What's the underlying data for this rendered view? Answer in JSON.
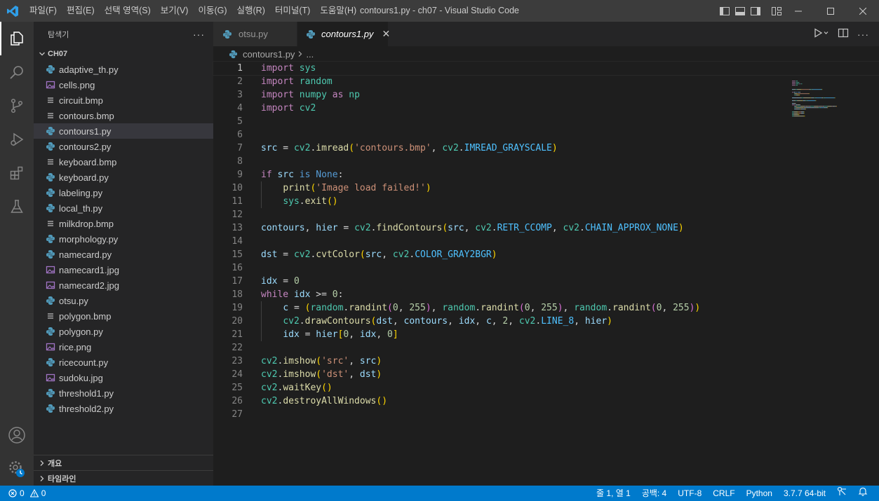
{
  "window": {
    "title": "contours1.py - ch07 - Visual Studio Code",
    "menu": [
      "파일(F)",
      "편집(E)",
      "선택 영역(S)",
      "보기(V)",
      "이동(G)",
      "실행(R)",
      "터미널(T)",
      "도움말(H)"
    ]
  },
  "sidebar": {
    "title": "탐색기",
    "folder": "CH07",
    "files": [
      {
        "name": "adaptive_th.py",
        "type": "python"
      },
      {
        "name": "cells.png",
        "type": "image"
      },
      {
        "name": "circuit.bmp",
        "type": "bitmap"
      },
      {
        "name": "contours.bmp",
        "type": "bitmap"
      },
      {
        "name": "contours1.py",
        "type": "python",
        "selected": true
      },
      {
        "name": "contours2.py",
        "type": "python"
      },
      {
        "name": "keyboard.bmp",
        "type": "bitmap"
      },
      {
        "name": "keyboard.py",
        "type": "python"
      },
      {
        "name": "labeling.py",
        "type": "python"
      },
      {
        "name": "local_th.py",
        "type": "python"
      },
      {
        "name": "milkdrop.bmp",
        "type": "bitmap"
      },
      {
        "name": "morphology.py",
        "type": "python"
      },
      {
        "name": "namecard.py",
        "type": "python"
      },
      {
        "name": "namecard1.jpg",
        "type": "image"
      },
      {
        "name": "namecard2.jpg",
        "type": "image"
      },
      {
        "name": "otsu.py",
        "type": "python"
      },
      {
        "name": "polygon.bmp",
        "type": "bitmap"
      },
      {
        "name": "polygon.py",
        "type": "python"
      },
      {
        "name": "rice.png",
        "type": "image"
      },
      {
        "name": "ricecount.py",
        "type": "python"
      },
      {
        "name": "sudoku.jpg",
        "type": "image"
      },
      {
        "name": "threshold1.py",
        "type": "python"
      },
      {
        "name": "threshold2.py",
        "type": "python"
      }
    ],
    "outline_label": "개요",
    "timeline_label": "타임라인"
  },
  "tabs": [
    {
      "label": "otsu.py",
      "active": false
    },
    {
      "label": "contours1.py",
      "active": true
    }
  ],
  "breadcrumb": {
    "file": "contours1.py",
    "more": "..."
  },
  "editor": {
    "current_line": 1,
    "lines": [
      [
        [
          "kw",
          "import"
        ],
        [
          "pl",
          " "
        ],
        [
          "md",
          "sys"
        ]
      ],
      [
        [
          "kw",
          "import"
        ],
        [
          "pl",
          " "
        ],
        [
          "md",
          "random"
        ]
      ],
      [
        [
          "kw",
          "import"
        ],
        [
          "pl",
          " "
        ],
        [
          "md",
          "numpy"
        ],
        [
          "pl",
          " "
        ],
        [
          "kw",
          "as"
        ],
        [
          "pl",
          " "
        ],
        [
          "md",
          "np"
        ]
      ],
      [
        [
          "kw",
          "import"
        ],
        [
          "pl",
          " "
        ],
        [
          "md",
          "cv2"
        ]
      ],
      [],
      [],
      [
        [
          "vr",
          "src"
        ],
        [
          "pl",
          " = "
        ],
        [
          "md",
          "cv2"
        ],
        [
          "pl",
          "."
        ],
        [
          "fn",
          "imread"
        ],
        [
          "br1",
          "("
        ],
        [
          "st",
          "'contours.bmp'"
        ],
        [
          "pl",
          ", "
        ],
        [
          "md",
          "cv2"
        ],
        [
          "pl",
          "."
        ],
        [
          "cn",
          "IMREAD_GRAYSCALE"
        ],
        [
          "br1",
          ")"
        ]
      ],
      [],
      [
        [
          "kw",
          "if"
        ],
        [
          "pl",
          " "
        ],
        [
          "vr",
          "src"
        ],
        [
          "pl",
          " "
        ],
        [
          "bl",
          "is"
        ],
        [
          "pl",
          " "
        ],
        [
          "bl",
          "None"
        ],
        [
          "pl",
          ":"
        ]
      ],
      [
        [
          "pl",
          "    "
        ],
        [
          "fn",
          "print"
        ],
        [
          "br1",
          "("
        ],
        [
          "st",
          "'Image load failed!'"
        ],
        [
          "br1",
          ")"
        ]
      ],
      [
        [
          "pl",
          "    "
        ],
        [
          "md",
          "sys"
        ],
        [
          "pl",
          "."
        ],
        [
          "fn",
          "exit"
        ],
        [
          "br1",
          "()"
        ]
      ],
      [],
      [
        [
          "vr",
          "contours"
        ],
        [
          "pl",
          ", "
        ],
        [
          "vr",
          "hier"
        ],
        [
          "pl",
          " = "
        ],
        [
          "md",
          "cv2"
        ],
        [
          "pl",
          "."
        ],
        [
          "fn",
          "findContours"
        ],
        [
          "br1",
          "("
        ],
        [
          "vr",
          "src"
        ],
        [
          "pl",
          ", "
        ],
        [
          "md",
          "cv2"
        ],
        [
          "pl",
          "."
        ],
        [
          "cn",
          "RETR_CCOMP"
        ],
        [
          "pl",
          ", "
        ],
        [
          "md",
          "cv2"
        ],
        [
          "pl",
          "."
        ],
        [
          "cn",
          "CHAIN_APPROX_NONE"
        ],
        [
          "br1",
          ")"
        ]
      ],
      [],
      [
        [
          "vr",
          "dst"
        ],
        [
          "pl",
          " = "
        ],
        [
          "md",
          "cv2"
        ],
        [
          "pl",
          "."
        ],
        [
          "fn",
          "cvtColor"
        ],
        [
          "br1",
          "("
        ],
        [
          "vr",
          "src"
        ],
        [
          "pl",
          ", "
        ],
        [
          "md",
          "cv2"
        ],
        [
          "pl",
          "."
        ],
        [
          "cn",
          "COLOR_GRAY2BGR"
        ],
        [
          "br1",
          ")"
        ]
      ],
      [],
      [
        [
          "vr",
          "idx"
        ],
        [
          "pl",
          " = "
        ],
        [
          "nm",
          "0"
        ]
      ],
      [
        [
          "kw",
          "while"
        ],
        [
          "pl",
          " "
        ],
        [
          "vr",
          "idx"
        ],
        [
          "pl",
          " >= "
        ],
        [
          "nm",
          "0"
        ],
        [
          "pl",
          ":"
        ]
      ],
      [
        [
          "pl",
          "    "
        ],
        [
          "vr",
          "c"
        ],
        [
          "pl",
          " = "
        ],
        [
          "br1",
          "("
        ],
        [
          "md",
          "random"
        ],
        [
          "pl",
          "."
        ],
        [
          "fn",
          "randint"
        ],
        [
          "br2",
          "("
        ],
        [
          "nm",
          "0"
        ],
        [
          "pl",
          ", "
        ],
        [
          "nm",
          "255"
        ],
        [
          "br2",
          ")"
        ],
        [
          "pl",
          ", "
        ],
        [
          "md",
          "random"
        ],
        [
          "pl",
          "."
        ],
        [
          "fn",
          "randint"
        ],
        [
          "br2",
          "("
        ],
        [
          "nm",
          "0"
        ],
        [
          "pl",
          ", "
        ],
        [
          "nm",
          "255"
        ],
        [
          "br2",
          ")"
        ],
        [
          "pl",
          ", "
        ],
        [
          "md",
          "random"
        ],
        [
          "pl",
          "."
        ],
        [
          "fn",
          "randint"
        ],
        [
          "br2",
          "("
        ],
        [
          "nm",
          "0"
        ],
        [
          "pl",
          ", "
        ],
        [
          "nm",
          "255"
        ],
        [
          "br2",
          ")"
        ],
        [
          "br1",
          ")"
        ]
      ],
      [
        [
          "pl",
          "    "
        ],
        [
          "md",
          "cv2"
        ],
        [
          "pl",
          "."
        ],
        [
          "fn",
          "drawContours"
        ],
        [
          "br1",
          "("
        ],
        [
          "vr",
          "dst"
        ],
        [
          "pl",
          ", "
        ],
        [
          "vr",
          "contours"
        ],
        [
          "pl",
          ", "
        ],
        [
          "vr",
          "idx"
        ],
        [
          "pl",
          ", "
        ],
        [
          "vr",
          "c"
        ],
        [
          "pl",
          ", "
        ],
        [
          "nm",
          "2"
        ],
        [
          "pl",
          ", "
        ],
        [
          "md",
          "cv2"
        ],
        [
          "pl",
          "."
        ],
        [
          "cn",
          "LINE_8"
        ],
        [
          "pl",
          ", "
        ],
        [
          "vr",
          "hier"
        ],
        [
          "br1",
          ")"
        ]
      ],
      [
        [
          "pl",
          "    "
        ],
        [
          "vr",
          "idx"
        ],
        [
          "pl",
          " = "
        ],
        [
          "vr",
          "hier"
        ],
        [
          "br1",
          "["
        ],
        [
          "nm",
          "0"
        ],
        [
          "pl",
          ", "
        ],
        [
          "vr",
          "idx"
        ],
        [
          "pl",
          ", "
        ],
        [
          "nm",
          "0"
        ],
        [
          "br1",
          "]"
        ]
      ],
      [],
      [
        [
          "md",
          "cv2"
        ],
        [
          "pl",
          "."
        ],
        [
          "fn",
          "imshow"
        ],
        [
          "br1",
          "("
        ],
        [
          "st",
          "'src'"
        ],
        [
          "pl",
          ", "
        ],
        [
          "vr",
          "src"
        ],
        [
          "br1",
          ")"
        ]
      ],
      [
        [
          "md",
          "cv2"
        ],
        [
          "pl",
          "."
        ],
        [
          "fn",
          "imshow"
        ],
        [
          "br1",
          "("
        ],
        [
          "st",
          "'dst'"
        ],
        [
          "pl",
          ", "
        ],
        [
          "vr",
          "dst"
        ],
        [
          "br1",
          ")"
        ]
      ],
      [
        [
          "md",
          "cv2"
        ],
        [
          "pl",
          "."
        ],
        [
          "fn",
          "waitKey"
        ],
        [
          "br1",
          "()"
        ]
      ],
      [
        [
          "md",
          "cv2"
        ],
        [
          "pl",
          "."
        ],
        [
          "fn",
          "destroyAllWindows"
        ],
        [
          "br1",
          "()"
        ]
      ],
      []
    ]
  },
  "statusbar": {
    "errors": "0",
    "warnings": "0",
    "position": "줄 1, 열 1",
    "spaces": "공백: 4",
    "encoding": "UTF-8",
    "eol": "CRLF",
    "language": "Python",
    "interpreter": "3.7.7 64-bit"
  },
  "colors": {
    "accent": "#007acc",
    "titlebar": "#3c3c3c",
    "sidebar": "#252526",
    "editor": "#1e1e1e",
    "python_icon": "#519aba",
    "image_icon": "#a074c4"
  }
}
